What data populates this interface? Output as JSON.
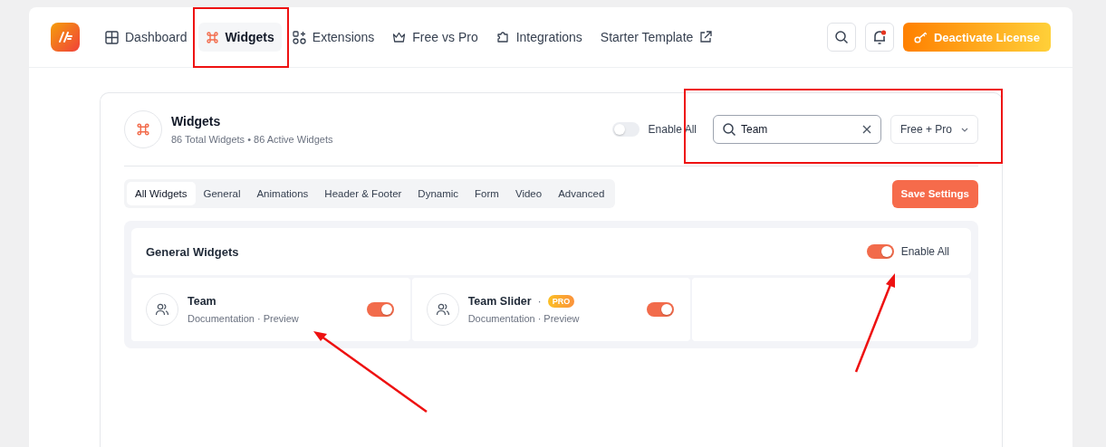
{
  "nav": [
    {
      "label": "Dashboard",
      "selected": false
    },
    {
      "label": "Widgets",
      "selected": true
    },
    {
      "label": "Extensions",
      "selected": false
    },
    {
      "label": "Free vs Pro",
      "selected": false
    },
    {
      "label": "Integrations",
      "selected": false
    },
    {
      "label": "Starter Template",
      "selected": false
    }
  ],
  "header_actions": {
    "notification_dot": true,
    "license_button": "Deactivate License"
  },
  "panel": {
    "title": "Widgets",
    "subtitle": "86 Total Widgets • 86 Active Widgets",
    "enable_all": {
      "label": "Enable All",
      "on": false
    },
    "search": {
      "value": "Team"
    },
    "filter": "Free + Pro"
  },
  "tabs": [
    {
      "label": "All Widgets",
      "selected": true
    },
    {
      "label": "General",
      "selected": false
    },
    {
      "label": "Animations",
      "selected": false
    },
    {
      "label": "Header & Footer",
      "selected": false
    },
    {
      "label": "Dynamic",
      "selected": false
    },
    {
      "label": "Form",
      "selected": false
    },
    {
      "label": "Video",
      "selected": false
    },
    {
      "label": "Advanced",
      "selected": false
    }
  ],
  "save_button": "Save Settings",
  "group": {
    "title": "General Widgets",
    "enable_all": {
      "label": "Enable All",
      "on": true
    },
    "widgets": [
      {
        "name": "Team",
        "links": [
          "Documentation",
          "Preview"
        ],
        "link_separator": "·",
        "on": true
      },
      {
        "name": "Team Slider",
        "name_separator": "·",
        "badge": "PRO",
        "links": [
          "Documentation",
          "Preview"
        ],
        "link_separator": "·",
        "on": true
      }
    ]
  }
}
